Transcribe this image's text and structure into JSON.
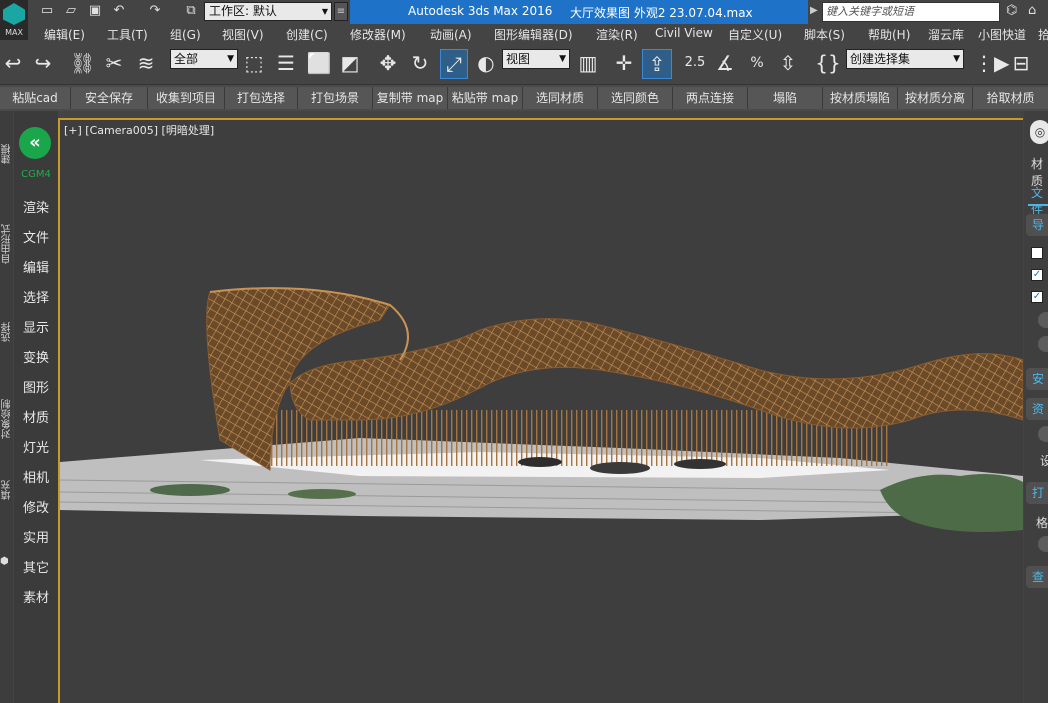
{
  "app": {
    "logo_text": "MAX"
  },
  "workspace": {
    "value": "工作区: 默认"
  },
  "title": {
    "app": "Autodesk 3ds Max 2016",
    "document": "大厅效果图  外观2 23.07.04.max"
  },
  "search": {
    "placeholder": "键入关键字或短语"
  },
  "menus": [
    "编辑(E)",
    "工具(T)",
    "组(G)",
    "视图(V)",
    "创建(C)",
    "修改器(M)",
    "动画(A)",
    "图形编辑器(D)",
    "渲染(R)",
    "Civil View",
    "自定义(U)",
    "脚本(S)",
    "帮助(H)",
    "溜云库",
    "小图快道",
    "拾"
  ],
  "toolbar": {
    "filter_select": "全部",
    "coord_select": "视图",
    "named_sel_select": "创建选择集",
    "snap_label": "2.5",
    "percent_label": "%"
  },
  "plugin_buttons": [
    "粘贴cad",
    "安全保存",
    "收集到项目",
    "打包选择",
    "打包场景",
    "复制带 map",
    "粘贴带 map",
    "选同材质",
    "选同颜色",
    "两点连接",
    "塌陷",
    "按材质塌陷",
    "按材质分离",
    "拾取材质"
  ],
  "left_strip": [
    "建模",
    "自由形式",
    "选择",
    "对象绘制",
    "填充"
  ],
  "cg_menu": {
    "brand": "CGM4",
    "items": [
      "渲染",
      "文件",
      "编辑",
      "选择",
      "显示",
      "变换",
      "图形",
      "材质",
      "灯光",
      "相机",
      "修改",
      "实用",
      "其它",
      "素材"
    ]
  },
  "viewport": {
    "label": "[+] [Camera005] [明暗处理]"
  },
  "right_panel": {
    "tab_materials": "材质",
    "tab_file": "文件",
    "sections": [
      "导",
      "安",
      "资",
      "打",
      "查"
    ],
    "labels": [
      "设",
      "格"
    ]
  },
  "colors": {
    "title_band": "#1e73c8",
    "viewport_border": "#c79a2a",
    "cg_green": "#1aa64a",
    "structure": "#a8743f"
  }
}
